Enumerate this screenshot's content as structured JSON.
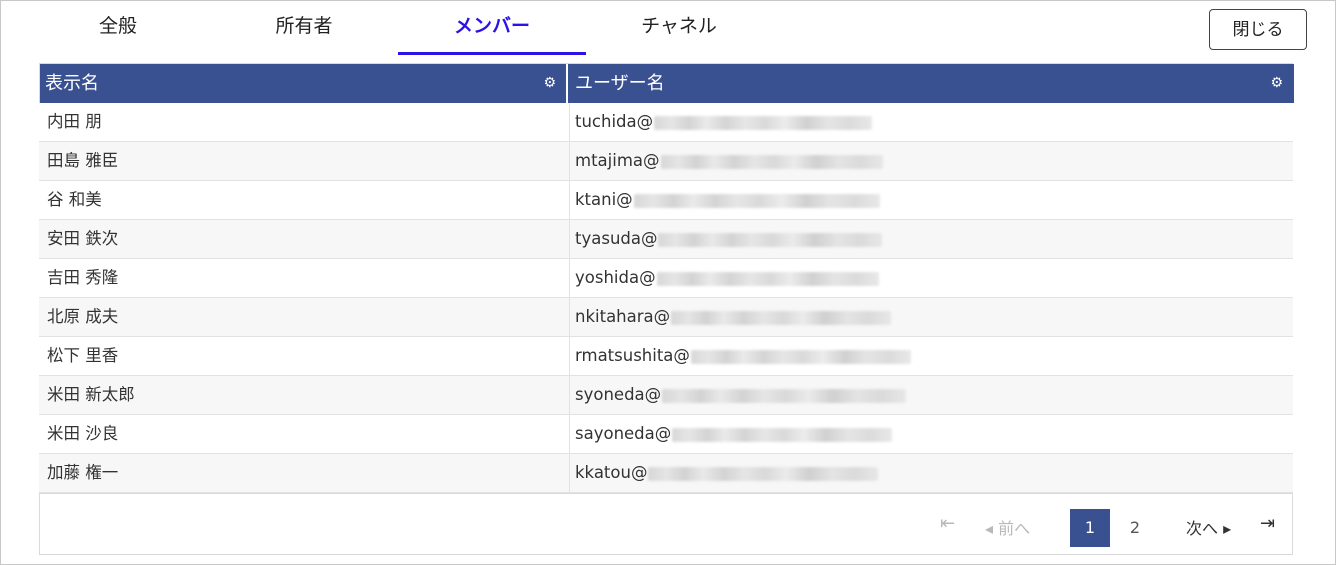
{
  "tabs": [
    {
      "label": "全般",
      "active": false
    },
    {
      "label": "所有者",
      "active": false
    },
    {
      "label": "メンバー",
      "active": true
    },
    {
      "label": "チャネル",
      "active": false
    }
  ],
  "close_button": "閉じる",
  "grid": {
    "columns": [
      "表示名",
      "ユーザー名"
    ],
    "rows": [
      {
        "name": "内田 朋",
        "user": "tuchida@"
      },
      {
        "name": "田島 雅臣",
        "user": "mtajima@"
      },
      {
        "name": "谷 和美",
        "user": "ktani@"
      },
      {
        "name": "安田 鉄次",
        "user": "tyasuda@"
      },
      {
        "name": "吉田 秀隆",
        "user": "yoshida@"
      },
      {
        "name": "北原 成夫",
        "user": "nkitahara@"
      },
      {
        "name": "松下 里香",
        "user": "rmatsushita@"
      },
      {
        "name": "米田 新太郎",
        "user": "syoneda@"
      },
      {
        "name": "米田 沙良",
        "user": "sayoneda@"
      },
      {
        "name": "加藤 権一",
        "user": "kkatou@"
      }
    ]
  },
  "pager": {
    "first_icon": "⇤",
    "prev_label": "◂ 前へ",
    "pages": [
      "1",
      "2"
    ],
    "current_page": "1",
    "next_label": "次へ ▸",
    "last_icon": "⇥"
  },
  "colors": {
    "accent": "#2b12e8",
    "header_bg": "#3a5191"
  }
}
